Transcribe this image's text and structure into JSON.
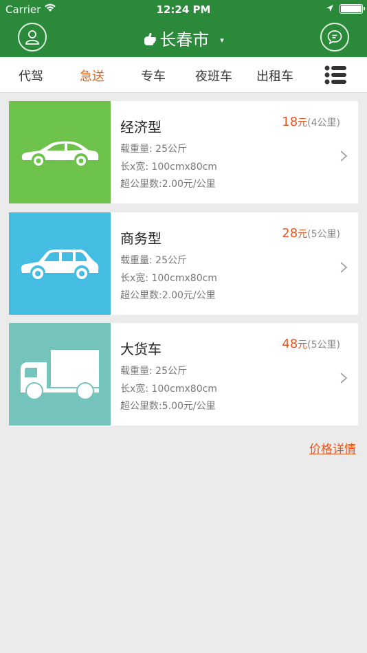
{
  "status_bar": {
    "carrier": "Carrier",
    "time": "12:24 PM"
  },
  "header": {
    "city": "长春市",
    "city_caret": "▾",
    "bg_color": "#2a8a3a",
    "left_icon": "user-icon",
    "right_icon": "message-icon"
  },
  "tabs": [
    {
      "label": "代驾",
      "active": false
    },
    {
      "label": "急送",
      "active": true
    },
    {
      "label": "专车",
      "active": false
    },
    {
      "label": "夜班车",
      "active": false
    },
    {
      "label": "出租车",
      "active": false
    }
  ],
  "menu_icon": "list-menu-icon",
  "vehicles": [
    {
      "name": "经济型",
      "price": "18",
      "price_unit": "元",
      "price_note": "(4公里)",
      "load": "载重量: 25公斤",
      "size": "长x宽: 100cmx80cm",
      "extra": "超公里数:2.00元/公里",
      "color": "#6cc24a",
      "icon": "sedan-car-icon"
    },
    {
      "name": "商务型",
      "price": "28",
      "price_unit": "元",
      "price_note": "(5公里)",
      "load": "载重量: 25公斤",
      "size": "长x宽: 100cmx80cm",
      "extra": "超公里数:2.00元/公里",
      "color": "#45bde3",
      "icon": "suv-car-icon"
    },
    {
      "name": "大货车",
      "price": "48",
      "price_unit": "元",
      "price_note": "(5公里)",
      "load": "载重量: 25公斤",
      "size": "长x宽: 100cmx80cm",
      "extra": "超公里数:5.00元/公里",
      "color": "#74c4bc",
      "icon": "truck-icon"
    }
  ],
  "price_details_link": "价格详情",
  "accent_color": "#e8561f"
}
